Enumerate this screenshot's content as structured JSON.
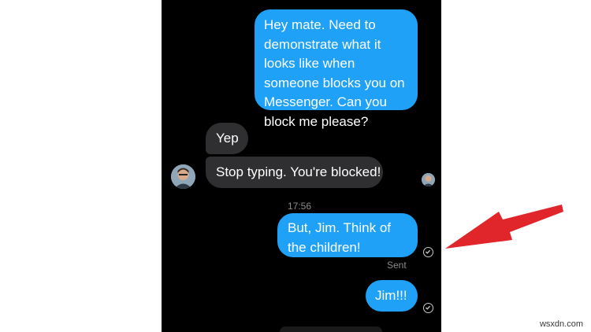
{
  "conversation": {
    "outgoing_1": "Hey mate. Need to demonstrate what it looks like when someone blocks you on Messenger. Can you block me please?",
    "incoming_1": "Yep",
    "incoming_2": "Stop typing. You're blocked!",
    "timestamp": "17:56",
    "outgoing_2": "But, Jim. Think of the children!",
    "status_sent": "Sent",
    "outgoing_3": "Jim!!!"
  },
  "annotation": {
    "arrow_color": "#e0252b"
  },
  "colors": {
    "outgoing_bubble": "#1ea1f7",
    "incoming_bubble": "#2f2f31",
    "background": "#000000"
  },
  "icons": {
    "avatar": "contact-avatar-icon",
    "read_receipt": "read-receipt-avatar-icon",
    "delivered": "check-circle-icon"
  },
  "watermark": "wsxdn.com"
}
